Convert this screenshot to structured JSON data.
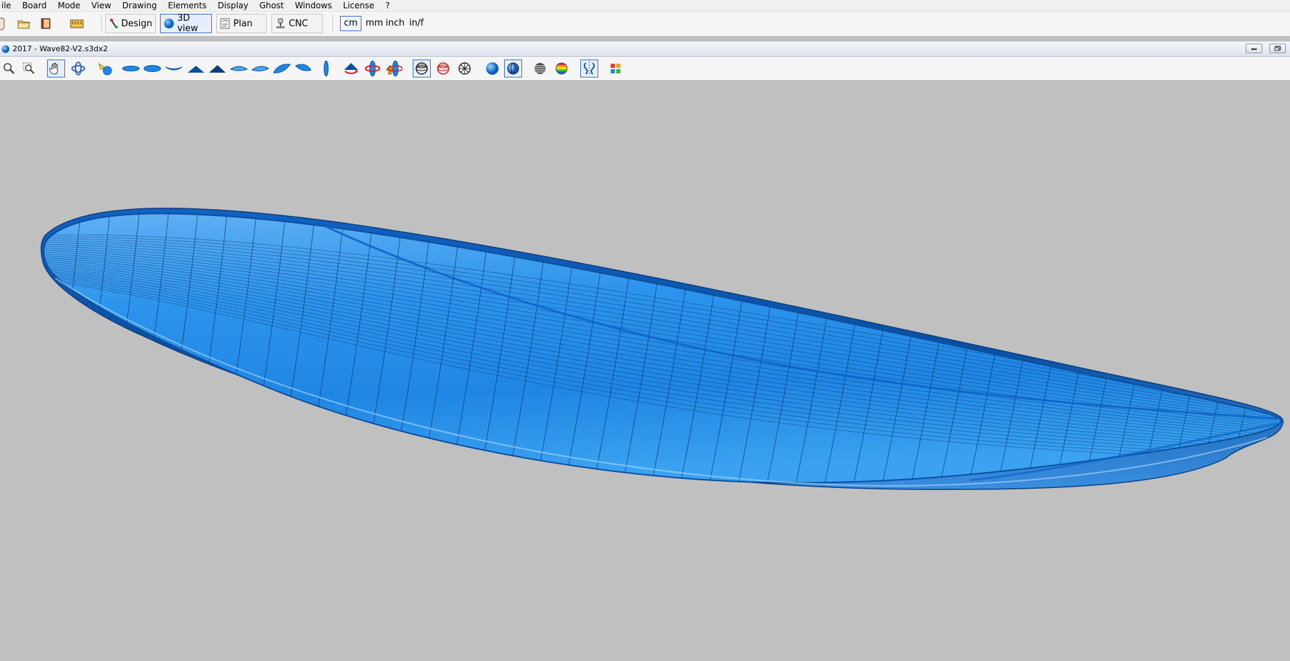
{
  "menu": {
    "items": [
      "ile",
      "Board",
      "Mode",
      "View",
      "Drawing",
      "Elements",
      "Display",
      "Ghost",
      "Windows",
      "License",
      "?"
    ]
  },
  "toolbar": {
    "modes": {
      "design": "Design",
      "view3d": "3D view",
      "plan": "Plan",
      "cnc": "CNC"
    },
    "units": {
      "cm": "cm",
      "mm": "mm",
      "inch": "inch",
      "inf": "in/f"
    },
    "active_mode": "3D view",
    "active_unit": "cm",
    "icons": [
      "hand-pointer-icon",
      "open-folder-icon",
      "save-book-icon",
      "measure-icon"
    ]
  },
  "document": {
    "title": "2017 - Wave82-V2.s3dx2",
    "icon": "globe-icon"
  },
  "view_toolbar": {
    "icons": [
      "zoom-icon",
      "zoom-window-icon",
      "pan-hand-icon",
      "rotate-icon",
      "light-icon",
      "view-top-icon",
      "view-bottom-icon",
      "view-rocker-icon",
      "view-front-icon",
      "view-back-icon",
      "view-tail-icon",
      "view-nose-icon",
      "view-side-left-icon",
      "view-side-right-icon",
      "view-edge-icon",
      "orbit-icon",
      "rotate-axes-icon",
      "move-light-icon",
      "render-wire-icon",
      "render-shaded-icon",
      "render-mesh-icon",
      "render-smooth-icon",
      "render-hybrid-icon",
      "stripes-icon",
      "zebra-icon",
      "symmetry-icon",
      "colors-icon"
    ]
  },
  "viewport": {
    "background": "#c0c0c0",
    "board_color": "#1e88e5",
    "board_dark": "#0a57b0",
    "board_light": "#6fb6f5"
  }
}
